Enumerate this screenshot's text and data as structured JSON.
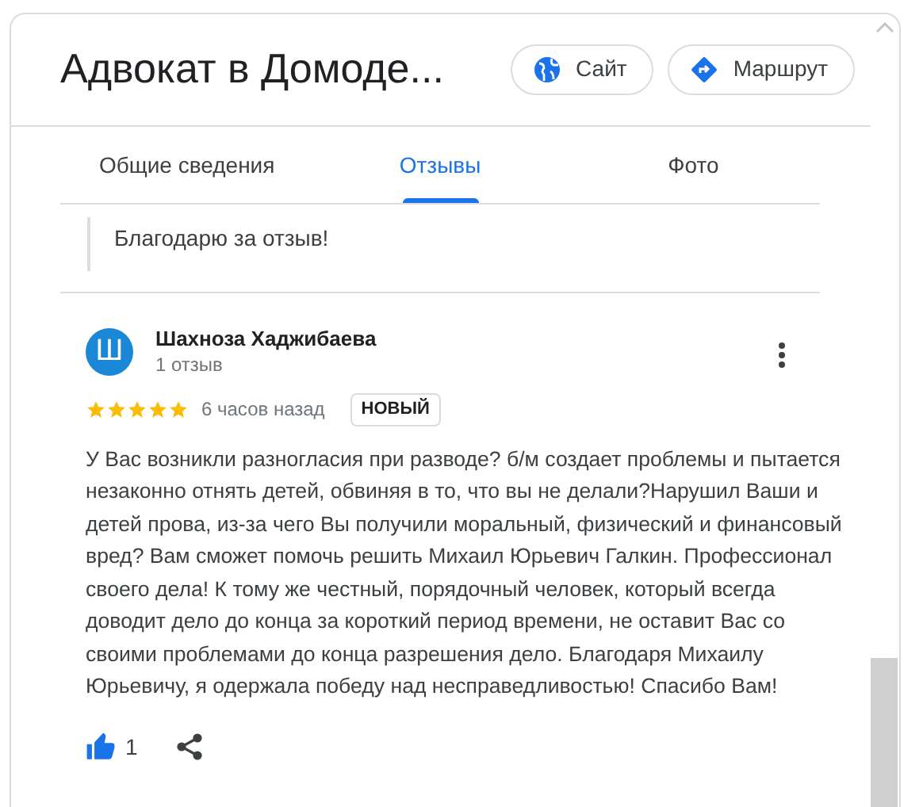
{
  "header": {
    "title": "Адвокат в Домоде...",
    "buttons": [
      {
        "kind": "website",
        "label": "Сайт"
      },
      {
        "kind": "directions",
        "label": "Маршрут"
      }
    ]
  },
  "tabs": [
    {
      "label": "Общие сведения",
      "selected": false
    },
    {
      "label": "Отзывы",
      "selected": true
    },
    {
      "label": "Фото",
      "selected": false
    }
  ],
  "owner_reply": {
    "text": "Благодарю за отзыв!"
  },
  "review": {
    "avatar_letter": "Ш",
    "author": "Шахноза Хаджибаева",
    "author_meta": "1 отзыв",
    "stars": 5,
    "time": "6 часов назад",
    "badge": "НОВЫЙ",
    "text": "У Вас возникли разногласия при разводе? б/м создает проблемы и пытается незаконно отнять детей, обвиняя в то, что вы не делали?Нарушил Ваши и детей прова, из-за чего Вы получили моральный, физический и финансовый вред? Вам сможет помочь решить Михаил Юрьевич Галкин. Профессионал своего дела! К тому же честный, порядочный человек, который всегда доводит дело до конца за короткий период времени, не оставит Вас со своими проблемами до конца разрешения дело. Благодаря Михаилу Юрьевичу, я одержала победу над несправедливостью! Спасибо Вам!",
    "likes": "1",
    "liked": true
  }
}
